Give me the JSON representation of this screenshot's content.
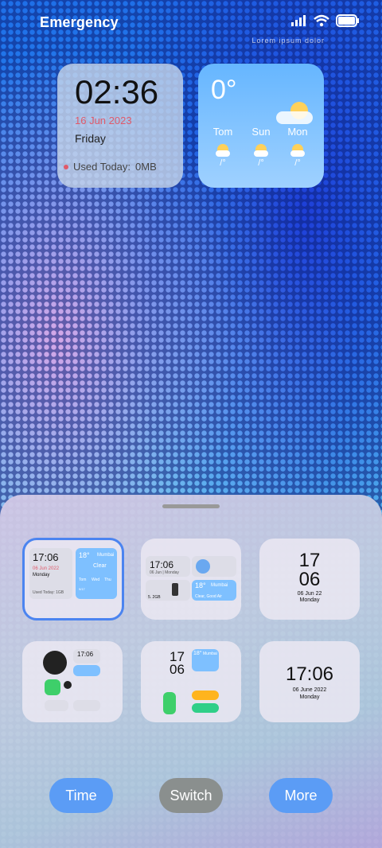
{
  "status": {
    "carrier": "Emergency",
    "sub": "Lorem ipsum dolor"
  },
  "time_widget": {
    "clock": "02:36",
    "date": "16 Jun 2023",
    "day": "Friday",
    "used_label": "Used Today:",
    "used_value": "0MB"
  },
  "weather_widget": {
    "temp": "0°",
    "forecast": [
      {
        "day": "Tom",
        "range": "/°"
      },
      {
        "day": "Sun",
        "range": "/°"
      },
      {
        "day": "Mon",
        "range": "/°"
      }
    ]
  },
  "picker": {
    "card1": {
      "time": "17:06",
      "date": "06 Jun 2022",
      "day": "Monday",
      "used": "Used Today: 1GB",
      "temp": "18°",
      "city": "Mumbai",
      "cond": "Clear",
      "d1": "Tom",
      "d2": "Wed",
      "d3": "Thu",
      "r": "9/17"
    },
    "card2": {
      "time": "17:06",
      "date": "06 Jun | Monday",
      "storage": "5. 2GB",
      "temp": "18°",
      "city": "Mumbai",
      "cond": "Clear, Good Air"
    },
    "card3": {
      "hour": "17",
      "min": "06",
      "date": "06 Jun 22",
      "day": "Monday"
    },
    "card4": {
      "time": "17:06"
    },
    "card5": {
      "hour": "17",
      "min": "06",
      "temp": "18°",
      "city": "Mumbai"
    },
    "card6": {
      "time": "17:06",
      "date": "06 June 2022",
      "day": "Monday"
    }
  },
  "buttons": {
    "time": "Time",
    "switch": "Switch",
    "more": "More"
  }
}
